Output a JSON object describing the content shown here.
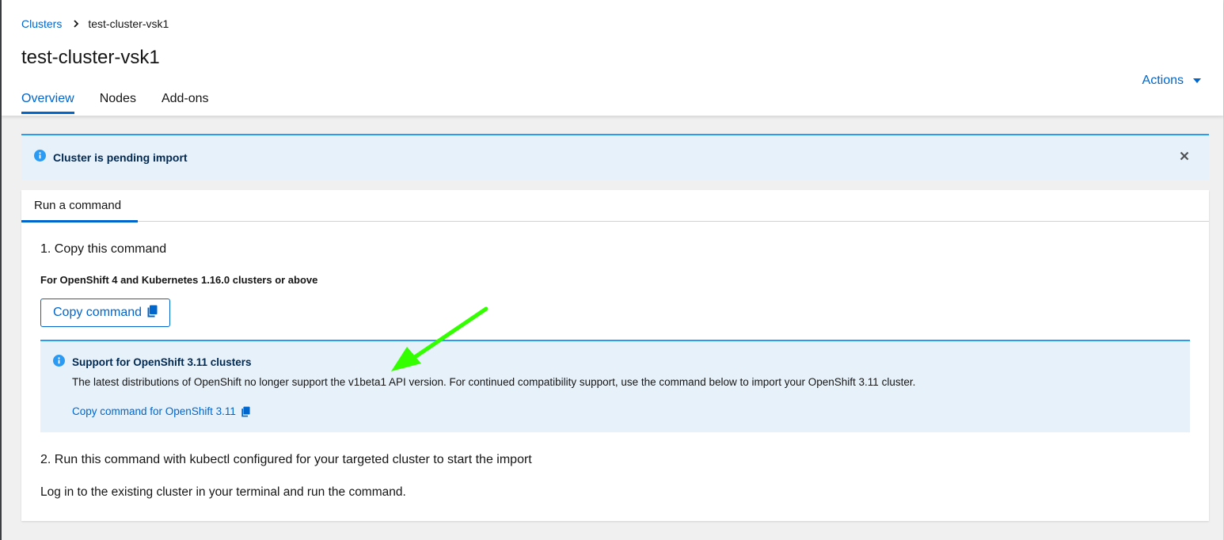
{
  "breadcrumb": {
    "parent": "Clusters",
    "current": "test-cluster-vsk1"
  },
  "page": {
    "title": "test-cluster-vsk1",
    "actions_label": "Actions"
  },
  "tabs": [
    {
      "label": "Overview",
      "active": true
    },
    {
      "label": "Nodes",
      "active": false
    },
    {
      "label": "Add-ons",
      "active": false
    }
  ],
  "alert": {
    "title": "Cluster is pending import"
  },
  "card": {
    "tab_label": "Run a command",
    "step1_title": "1. Copy this command",
    "step1_subtitle": "For OpenShift 4 and Kubernetes 1.16.0 clusters or above",
    "copy_button_label": "Copy command",
    "inline_alert": {
      "title": "Support for OpenShift 3.11 clusters",
      "body": "The latest distributions of OpenShift no longer support the v1beta1 API version. For continued compatibility support, use the command below to import your OpenShift 3.11 cluster.",
      "link_label": "Copy command for OpenShift 3.11"
    },
    "step2_title": "2. Run this command with kubectl configured for your targeted cluster to start the import",
    "step2_text": "Log in to the existing cluster in your terminal and run the command."
  },
  "colors": {
    "link": "#0066cc",
    "info_bg": "#e7f1fa",
    "info_border": "#2b9af3",
    "annotation_arrow": "#33ff00"
  },
  "icons": {
    "breadcrumb_separator": "chevron-right-icon",
    "actions_caret": "caret-down-icon",
    "alert_info": "info-circle-icon",
    "alert_close": "close-icon",
    "copy": "copy-icon",
    "annotation": "green-arrow"
  }
}
